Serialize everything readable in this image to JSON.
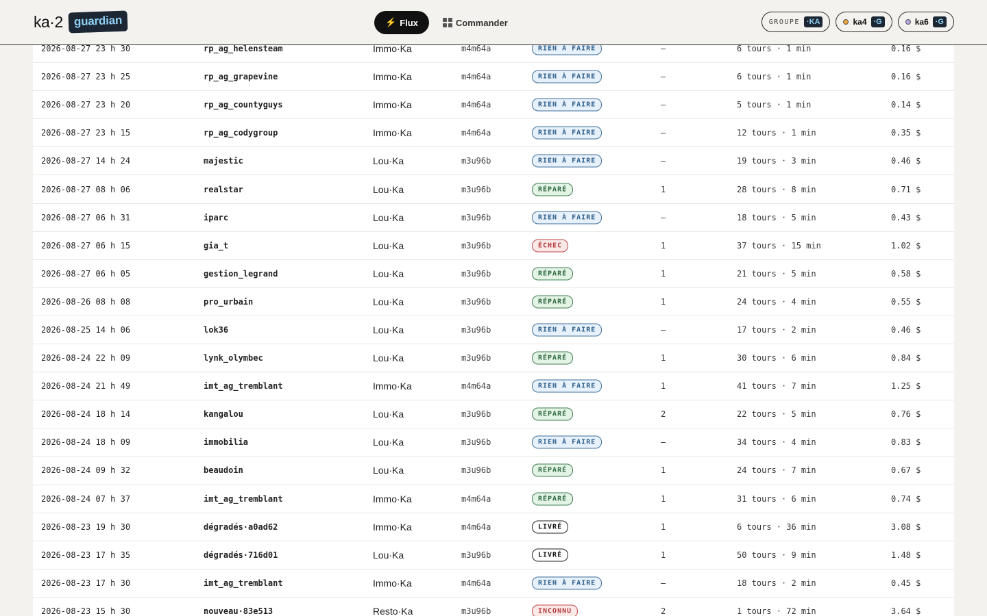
{
  "header": {
    "logo_text": "ka·2",
    "logo_badge": "guardian",
    "nav": {
      "flux_label": "Flux",
      "commander_label": "Commander"
    },
    "pills": [
      {
        "label": "GROUPE",
        "tag": "·KA"
      },
      {
        "name": "ka4",
        "tag": "·G",
        "dot_color": "#f0a43a"
      },
      {
        "name": "ka6",
        "tag": "·G",
        "dot_color": "#b9a5e8"
      }
    ]
  },
  "rows": [
    {
      "date": "2026-08-27 23 h 30",
      "name": "rp_ag_helensteam",
      "client": "Immo·Ka",
      "ref": "m4m64a",
      "status": "RIEN À FAIRE",
      "kind": "rien",
      "count": "—",
      "tours": "6 tours · 1 min",
      "cost": "0.16 $"
    },
    {
      "date": "2026-08-27 23 h 25",
      "name": "rp_ag_grapevine",
      "client": "Immo·Ka",
      "ref": "m4m64a",
      "status": "RIEN À FAIRE",
      "kind": "rien",
      "count": "—",
      "tours": "6 tours · 1 min",
      "cost": "0.16 $"
    },
    {
      "date": "2026-08-27 23 h 20",
      "name": "rp_ag_countyguys",
      "client": "Immo·Ka",
      "ref": "m4m64a",
      "status": "RIEN À FAIRE",
      "kind": "rien",
      "count": "—",
      "tours": "5 tours · 1 min",
      "cost": "0.14 $"
    },
    {
      "date": "2026-08-27 23 h 15",
      "name": "rp_ag_codygroup",
      "client": "Immo·Ka",
      "ref": "m4m64a",
      "status": "RIEN À FAIRE",
      "kind": "rien",
      "count": "—",
      "tours": "12 tours · 1 min",
      "cost": "0.35 $"
    },
    {
      "date": "2026-08-27 14 h 24",
      "name": "majestic",
      "client": "Lou·Ka",
      "ref": "m3u96b",
      "status": "RIEN À FAIRE",
      "kind": "rien",
      "count": "—",
      "tours": "19 tours · 3 min",
      "cost": "0.46 $"
    },
    {
      "date": "2026-08-27 08 h 06",
      "name": "realstar",
      "client": "Lou·Ka",
      "ref": "m3u96b",
      "status": "RÉPARÉ",
      "kind": "repare",
      "count": "1",
      "tours": "28 tours · 8 min",
      "cost": "0.71 $"
    },
    {
      "date": "2026-08-27 06 h 31",
      "name": "iparc",
      "client": "Lou·Ka",
      "ref": "m3u96b",
      "status": "RIEN À FAIRE",
      "kind": "rien",
      "count": "—",
      "tours": "18 tours · 5 min",
      "cost": "0.43 $"
    },
    {
      "date": "2026-08-27 06 h 15",
      "name": "gia_t",
      "client": "Lou·Ka",
      "ref": "m3u96b",
      "status": "ÉCHEC",
      "kind": "echec",
      "count": "1",
      "tours": "37 tours · 15 min",
      "cost": "1.02 $"
    },
    {
      "date": "2026-08-27 06 h 05",
      "name": "gestion_legrand",
      "client": "Lou·Ka",
      "ref": "m3u96b",
      "status": "RÉPARÉ",
      "kind": "repare",
      "count": "1",
      "tours": "21 tours · 5 min",
      "cost": "0.58 $"
    },
    {
      "date": "2026-08-26 08 h 08",
      "name": "pro_urbain",
      "client": "Lou·Ka",
      "ref": "m3u96b",
      "status": "RÉPARÉ",
      "kind": "repare",
      "count": "1",
      "tours": "24 tours · 4 min",
      "cost": "0.55 $"
    },
    {
      "date": "2026-08-25 14 h 06",
      "name": "lok36",
      "client": "Lou·Ka",
      "ref": "m3u96b",
      "status": "RIEN À FAIRE",
      "kind": "rien",
      "count": "—",
      "tours": "17 tours · 2 min",
      "cost": "0.46 $"
    },
    {
      "date": "2026-08-24 22 h 09",
      "name": "lynk_olymbec",
      "client": "Lou·Ka",
      "ref": "m3u96b",
      "status": "RÉPARÉ",
      "kind": "repare",
      "count": "1",
      "tours": "30 tours · 6 min",
      "cost": "0.84 $"
    },
    {
      "date": "2026-08-24 21 h 49",
      "name": "imt_ag_tremblant",
      "client": "Immo·Ka",
      "ref": "m4m64a",
      "status": "RIEN À FAIRE",
      "kind": "rien",
      "count": "1",
      "tours": "41 tours · 7 min",
      "cost": "1.25 $"
    },
    {
      "date": "2026-08-24 18 h 14",
      "name": "kangalou",
      "client": "Lou·Ka",
      "ref": "m3u96b",
      "status": "RÉPARÉ",
      "kind": "repare",
      "count": "2",
      "tours": "22 tours · 5 min",
      "cost": "0.76 $"
    },
    {
      "date": "2026-08-24 18 h 09",
      "name": "immobilia",
      "client": "Lou·Ka",
      "ref": "m3u96b",
      "status": "RIEN À FAIRE",
      "kind": "rien",
      "count": "—",
      "tours": "34 tours · 4 min",
      "cost": "0.83 $"
    },
    {
      "date": "2026-08-24 09 h 32",
      "name": "beaudoin",
      "client": "Lou·Ka",
      "ref": "m3u96b",
      "status": "RÉPARÉ",
      "kind": "repare",
      "count": "1",
      "tours": "24 tours · 7 min",
      "cost": "0.67 $"
    },
    {
      "date": "2026-08-24 07 h 37",
      "name": "imt_ag_tremblant",
      "client": "Immo·Ka",
      "ref": "m4m64a",
      "status": "RÉPARÉ",
      "kind": "repare",
      "count": "1",
      "tours": "31 tours · 6 min",
      "cost": "0.74 $"
    },
    {
      "date": "2026-08-23 19 h 30",
      "name": "dégradés·a0ad62",
      "client": "Immo·Ka",
      "ref": "m4m64a",
      "status": "LIVRÉ",
      "kind": "livre",
      "count": "1",
      "tours": "6 tours · 36 min",
      "cost": "3.08 $"
    },
    {
      "date": "2026-08-23 17 h 35",
      "name": "dégradés·716d01",
      "client": "Lou·Ka",
      "ref": "m3u96b",
      "status": "LIVRÉ",
      "kind": "livre",
      "count": "1",
      "tours": "50 tours · 9 min",
      "cost": "1.48 $"
    },
    {
      "date": "2026-08-23 17 h 30",
      "name": "imt_ag_tremblant",
      "client": "Immo·Ka",
      "ref": "m4m64a",
      "status": "RIEN À FAIRE",
      "kind": "rien",
      "count": "—",
      "tours": "18 tours · 2 min",
      "cost": "0.45 $"
    },
    {
      "date": "2026-08-23 15 h 30",
      "name": "nouveau·83e513",
      "client": "Resto·Ka",
      "ref": "m3u96b",
      "status": "INCONNU",
      "kind": "inconnu",
      "count": "2",
      "tours": "1 tours · 72 min",
      "cost": "3.64 $"
    }
  ]
}
